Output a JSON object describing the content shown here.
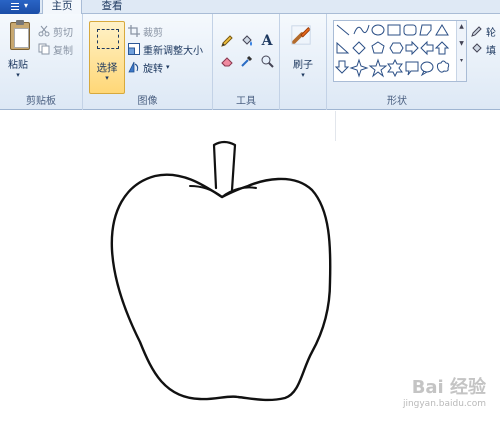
{
  "tabs": {
    "home": "主页",
    "view": "查看"
  },
  "clipboard": {
    "paste_label": "粘贴",
    "cut_label": "剪切",
    "copy_label": "复制",
    "group_label": "剪贴板"
  },
  "image": {
    "select_label": "选择",
    "crop_label": "裁剪",
    "resize_label": "重新调整大小",
    "rotate_label": "旋转",
    "group_label": "图像"
  },
  "tools": {
    "text_tool_glyph": "A",
    "group_label": "工具"
  },
  "brush": {
    "label": "刷子"
  },
  "shapes": {
    "group_label": "形状",
    "outline_label": "轮",
    "fill_label": "填"
  },
  "watermark": {
    "main": "Bai 经验",
    "sub": "jingyan.baidu.com"
  },
  "colors": {
    "file_button": "#2a64c5",
    "selected_tool": "#ffd777",
    "ribbon_bg": "#dde8f5"
  }
}
